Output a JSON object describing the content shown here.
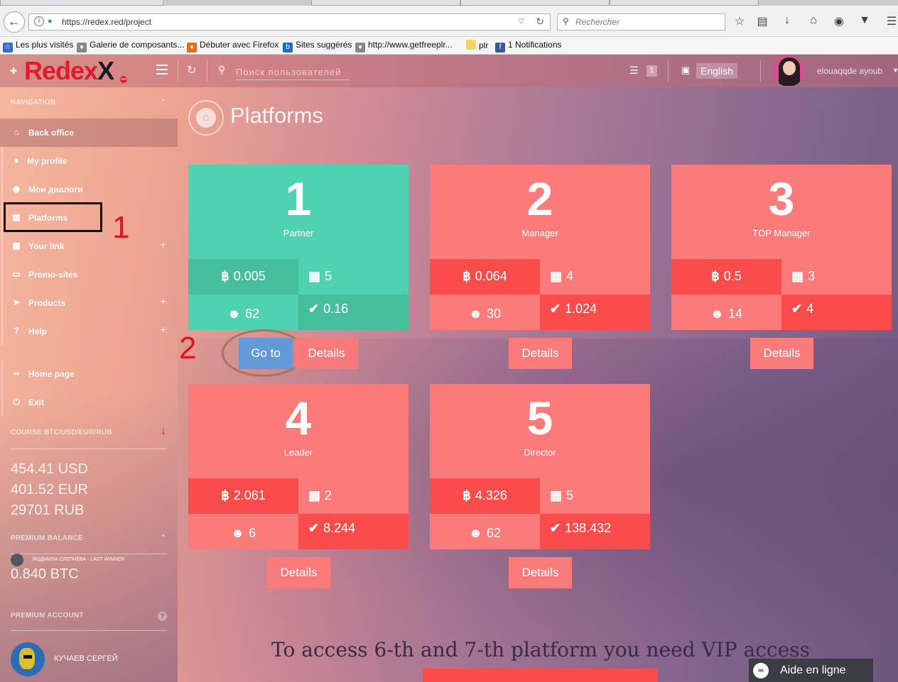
{
  "browser": {
    "url": "https://redex.red/project",
    "search_placeholder": "Rechercher",
    "bookmarks": [
      {
        "label": "Les plus visités",
        "icon": "bookmark-icon"
      },
      {
        "label": "Galerie de composants...",
        "icon": "globe-icon"
      },
      {
        "label": "Débuter avec Firefox",
        "icon": "firefox-icon"
      },
      {
        "label": "Sites suggérés",
        "icon": "b-icon"
      },
      {
        "label": "http://www.getfreeplr...",
        "icon": "globe-icon"
      },
      {
        "label": "plr",
        "icon": "folder-icon"
      },
      {
        "label": "1 Notifications",
        "icon": "facebook-icon"
      }
    ]
  },
  "header": {
    "logo": "Redex",
    "logo_x": "X",
    "logo_sup": "red",
    "search_placeholder": "Поиск пользователей",
    "messages_count": "1",
    "language": "English",
    "username": "elouaqqde ayoub"
  },
  "sidebar": {
    "nav_heading": "NAVIGATION",
    "items": [
      {
        "label": "Back office",
        "icon": "home-icon",
        "plus": ""
      },
      {
        "label": "My profile",
        "icon": "user-icon",
        "plus": ""
      },
      {
        "label": "Мои диалоги",
        "icon": "chat-icon",
        "plus": ""
      },
      {
        "label": "Platforms",
        "icon": "grid-icon",
        "plus": ""
      },
      {
        "label": "Your link",
        "icon": "bar-chart-icon",
        "plus": "+"
      },
      {
        "label": "Promo-sites",
        "icon": "monitor-icon",
        "plus": ""
      },
      {
        "label": "Products",
        "icon": "rocket-icon",
        "plus": "+"
      },
      {
        "label": "Help",
        "icon": "question-icon",
        "plus": "+"
      },
      {
        "label": "Home page",
        "icon": "link-icon",
        "plus": ""
      },
      {
        "label": "Exit",
        "icon": "power-icon",
        "plus": ""
      }
    ],
    "course_heading": "COURSE BTC/USD/EUR/RUB",
    "rates": [
      "454.41 USD",
      "401.52 EUR",
      "29701 RUB"
    ],
    "premium_heading": "PREMIUM BALANCE",
    "premium_balance": "0.840 BTC",
    "last_winner": "ЛЮДМИЛА СЛЕПНЁВА - LAST WINNER",
    "premium_account": "PREMIUM ACCOUNT",
    "bottom_user": "КУЧАЕВ СЕРГЕЙ"
  },
  "annotations": {
    "one": "1",
    "two": "2"
  },
  "main": {
    "title": "Platforms",
    "cards": [
      {
        "num": "1",
        "rank": "Partner",
        "btc": "0.005",
        "tables": "5",
        "users": "62",
        "checks": "0.16",
        "color": "#4fd2b0"
      },
      {
        "num": "2",
        "rank": "Manager",
        "btc": "0.064",
        "tables": "4",
        "users": "30",
        "checks": "1.024",
        "color": "#fb7a7a"
      },
      {
        "num": "3",
        "rank": "TOP Manager",
        "btc": "0.5",
        "tables": "3",
        "users": "14",
        "checks": "4",
        "color": "#fb7a7a"
      },
      {
        "num": "4",
        "rank": "Leader",
        "btc": "2.061",
        "tables": "2",
        "users": "6",
        "checks": "8.244",
        "color": "#fb7a7a"
      },
      {
        "num": "5",
        "rank": "Director",
        "btc": "4.326",
        "tables": "5",
        "users": "62",
        "checks": "138.432",
        "color": "#fb7a7a"
      }
    ],
    "goto_label": "Go to",
    "details_label": "Details",
    "vip_text": "To access 6-th and 7-th platform you need VIP access"
  },
  "chat": {
    "label": "Aide en ligne"
  }
}
